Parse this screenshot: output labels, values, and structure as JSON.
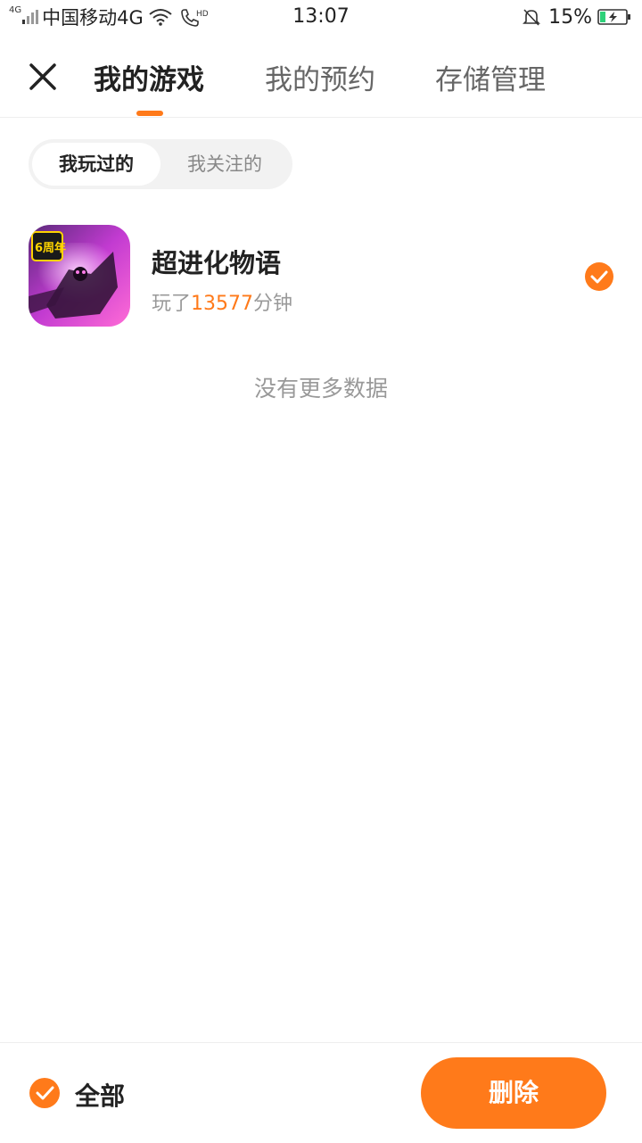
{
  "status_bar": {
    "signal_label": "4G",
    "carrier": "中国移动4G",
    "call_label": "HD",
    "time": "13:07",
    "battery_pct": "15%"
  },
  "header": {
    "tabs": [
      {
        "label": "我的游戏",
        "active": true
      },
      {
        "label": "我的预约",
        "active": false
      },
      {
        "label": "存储管理",
        "active": false
      }
    ]
  },
  "segment": {
    "options": [
      {
        "label": "我玩过的",
        "active": true
      },
      {
        "label": "我关注的",
        "active": false
      }
    ]
  },
  "games": [
    {
      "name": "超进化物语",
      "playtime_prefix": "玩了",
      "playtime_minutes": "13577",
      "playtime_suffix": "分钟",
      "icon_badge": "6周年",
      "selected": true
    }
  ],
  "list_footer": "没有更多数据",
  "bottom_bar": {
    "select_all_label": "全部",
    "delete_label": "删除"
  },
  "colors": {
    "accent": "#ff7a1a",
    "text_primary": "#222222",
    "text_secondary": "#999999"
  }
}
